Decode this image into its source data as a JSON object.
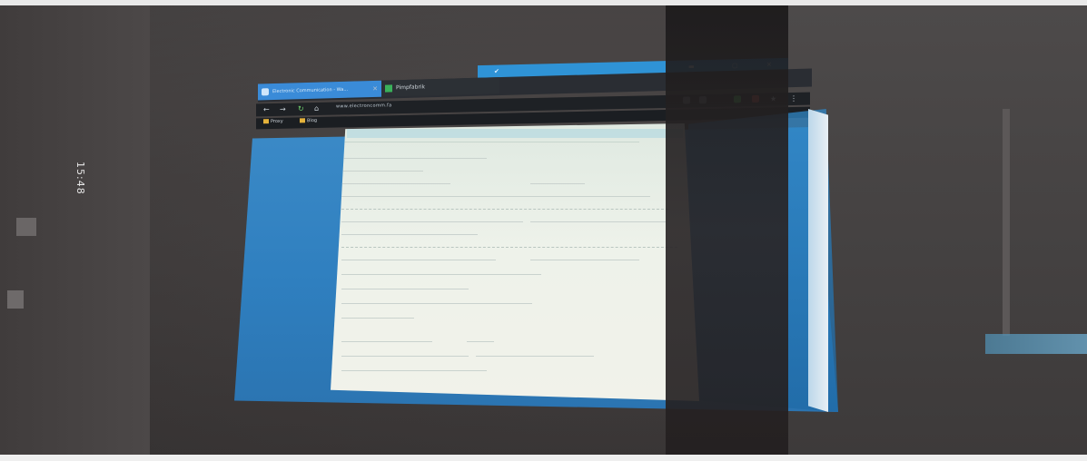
{
  "clock_text": "15:48",
  "browser": {
    "tabs": [
      {
        "label": "Electronic Communication - Wa...",
        "active": true,
        "icon": "mail-icon"
      },
      {
        "label": "Pimpfabrik",
        "active": false,
        "icon": "spreadsheet-icon"
      }
    ],
    "url": "www.electroncomm.fa",
    "bookmarks": [
      "Proxy",
      "Blog"
    ],
    "accent_color": "#3a8bd8"
  }
}
